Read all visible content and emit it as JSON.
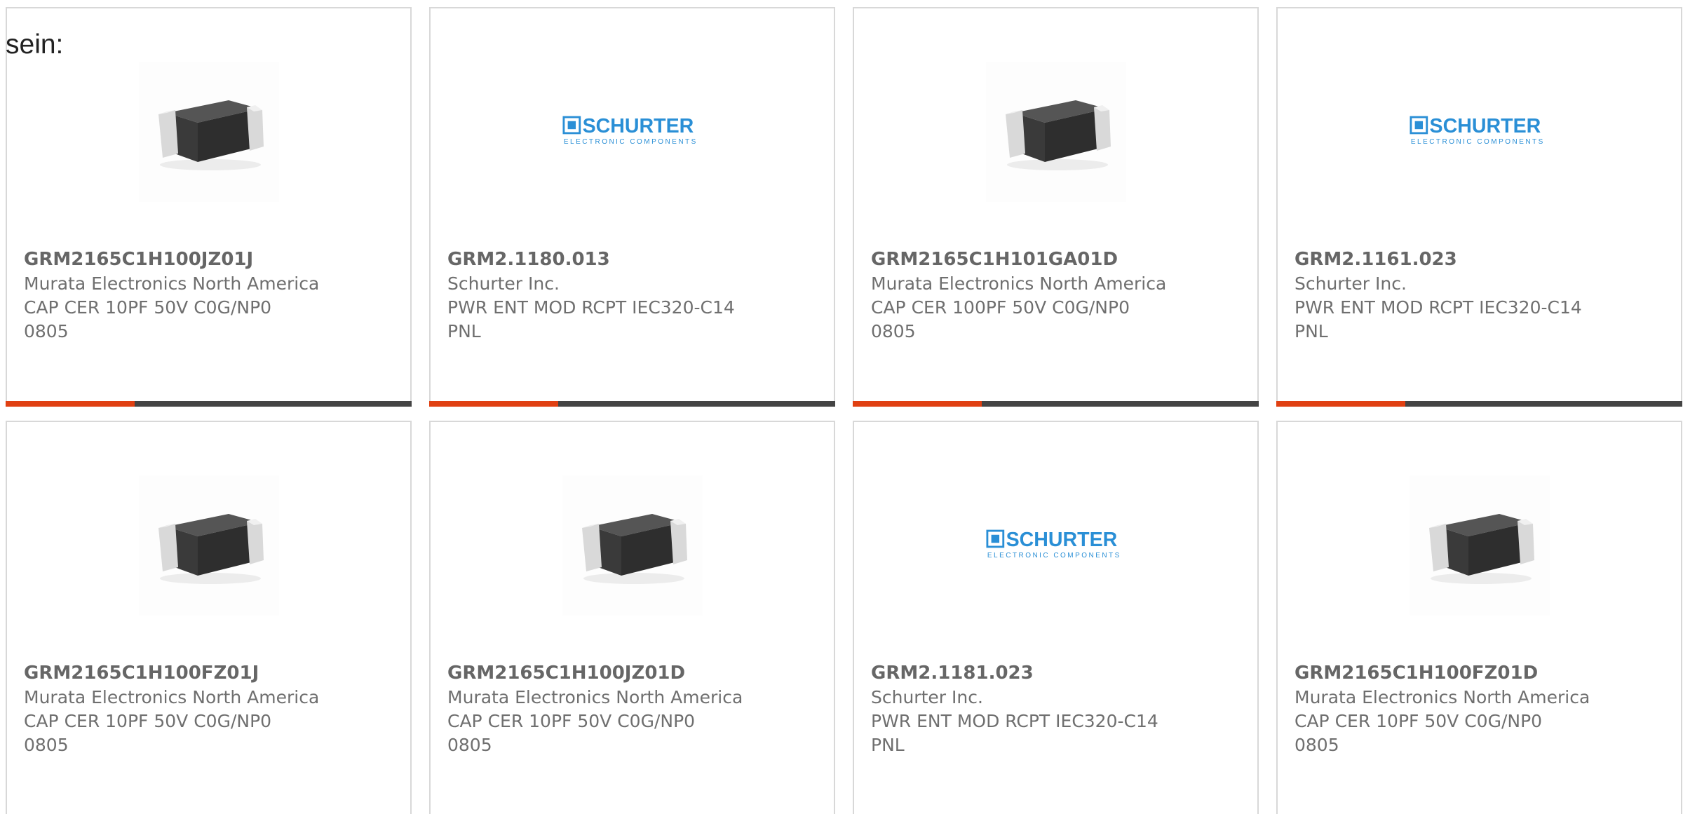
{
  "intro_text": "sein:",
  "colors": {
    "accent": "#e04012",
    "bar": "#444444",
    "logo_blue": "#2a8fd6",
    "chip_body": "#3a3a3a",
    "chip_terminal": "#d9d9d9"
  },
  "logo": {
    "brand": "SCHURTER",
    "tagline": "ELECTRONIC COMPONENTS"
  },
  "products": [
    {
      "part_number": "GRM2165C1H100JZ01J",
      "manufacturer": "Murata Electronics North America",
      "description": "CAP CER 10PF 50V C0G/NP0\n0805",
      "image": "chip-capacitor-image"
    },
    {
      "part_number": "GRM2.1180.013",
      "manufacturer": "Schurter Inc.",
      "description": "PWR ENT MOD RCPT IEC320-C14\nPNL",
      "image": "schurter-logo"
    },
    {
      "part_number": "GRM2165C1H101GA01D",
      "manufacturer": "Murata Electronics North America",
      "description": "CAP CER 100PF 50V C0G/NP0\n0805",
      "image": "chip-capacitor-image"
    },
    {
      "part_number": "GRM2.1161.023",
      "manufacturer": "Schurter Inc.",
      "description": "PWR ENT MOD RCPT IEC320-C14\nPNL",
      "image": "schurter-logo"
    },
    {
      "part_number": "GRM2165C1H100FZ01J",
      "manufacturer": "Murata Electronics North America",
      "description": "CAP CER 10PF 50V C0G/NP0\n0805",
      "image": "chip-capacitor-image"
    },
    {
      "part_number": "GRM2165C1H100JZ01D",
      "manufacturer": "Murata Electronics North America",
      "description": "CAP CER 10PF 50V C0G/NP0\n0805",
      "image": "chip-capacitor-image"
    },
    {
      "part_number": "GRM2.1181.023",
      "manufacturer": "Schurter Inc.",
      "description": "PWR ENT MOD RCPT IEC320-C14\nPNL",
      "image": "schurter-logo"
    },
    {
      "part_number": "GRM2165C1H100FZ01D",
      "manufacturer": "Murata Electronics North America",
      "description": "CAP CER 10PF 50V C0G/NP0\n0805",
      "image": "chip-capacitor-image"
    }
  ]
}
